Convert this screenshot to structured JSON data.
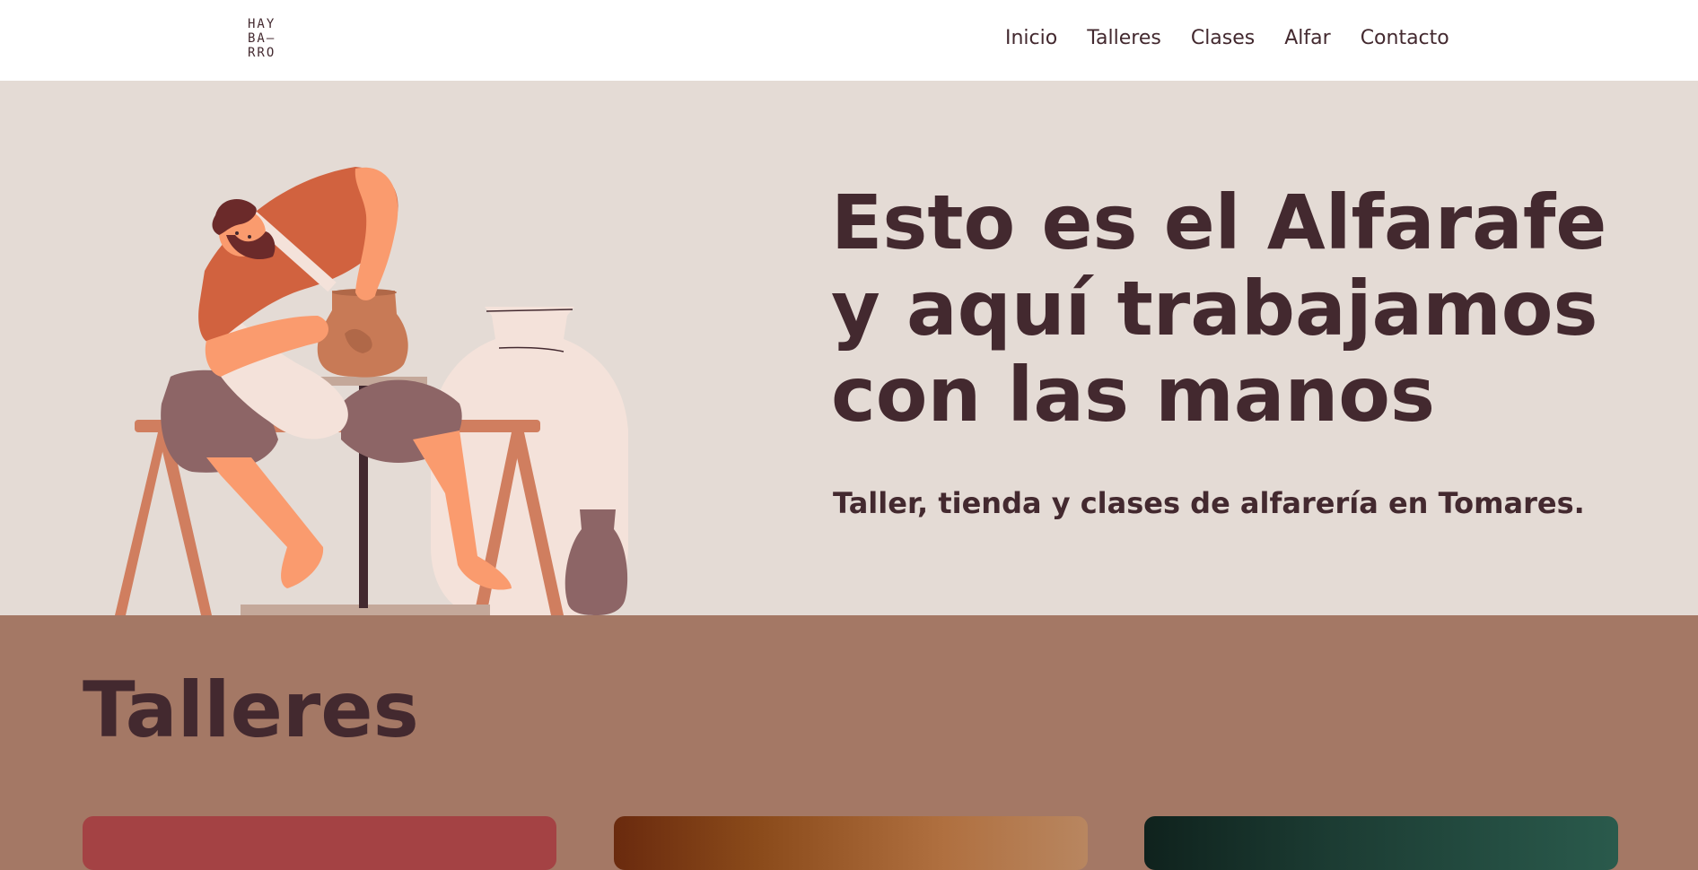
{
  "header": {
    "logo_lines": [
      "HAY",
      "BA–",
      "RRO"
    ],
    "nav": [
      "Inicio",
      "Talleres",
      "Clases",
      "Alfar",
      "Contacto"
    ]
  },
  "hero": {
    "title_lines": [
      "Esto es el Alfarafe",
      "y aquí trabajamos",
      "con las manos"
    ],
    "subtitle": "Taller, tienda y clases de alfarería en Tomares."
  },
  "talleres": {
    "title": "Talleres"
  },
  "colors": {
    "header_bg": "#ffffff",
    "hero_bg": "#e4dbd5",
    "section_bg": "#a47865",
    "text_dark": "#43292f",
    "accent_terracotta": "#d1623f",
    "accent_skin": "#fa9b6e",
    "accent_mauve": "#8d6566",
    "card_red": "#a44244"
  }
}
